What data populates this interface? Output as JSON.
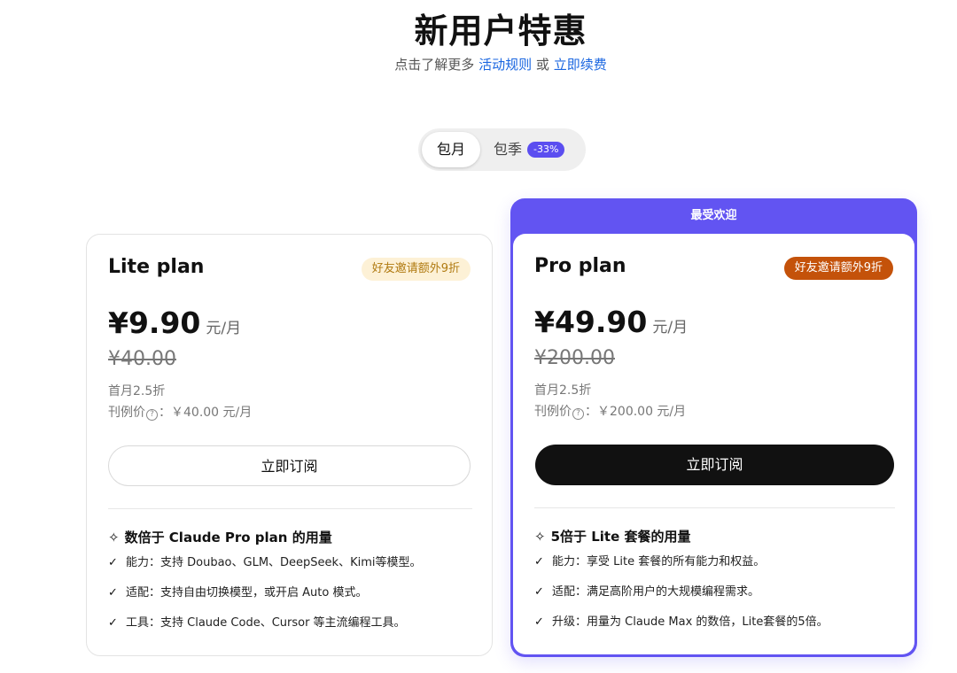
{
  "header": {
    "title": "新用户特惠",
    "subtitle_prefix": "点击了解更多",
    "rules_link": "活动规则",
    "or": "或",
    "renew_link": "立即续费"
  },
  "toggle": {
    "monthly": "包月",
    "quarterly": "包季",
    "quarterly_badge": "-33%",
    "selected": "包月"
  },
  "colors": {
    "accent": "#6254f2",
    "link": "#1a66e0",
    "pro_tag": "#c4520a"
  },
  "plans": [
    {
      "name": "Lite plan",
      "invite_tag": "好友邀请额外9折",
      "price": "¥9.90",
      "unit": "元/月",
      "original_price": "¥40.00",
      "discount": "首月2.5折",
      "ref_label": "刊例价",
      "ref_value": "：￥40.00 元/月",
      "subscribe": "立即订阅",
      "features_title": "数倍于 Claude Pro plan 的用量",
      "features": [
        "能力：支持 Doubao、GLM、DeepSeek、Kimi等模型。",
        "适配：支持自由切换模型，或开启 Auto 模式。",
        "工具：支持 Claude Code、Cursor 等主流编程工具。"
      ]
    },
    {
      "name": "Pro plan",
      "banner": "最受欢迎",
      "invite_tag": "好友邀请额外9折",
      "price": "¥49.90",
      "unit": "元/月",
      "original_price": "¥200.00",
      "discount": "首月2.5折",
      "ref_label": "刊例价",
      "ref_value": "：￥200.00 元/月",
      "subscribe": "立即订阅",
      "features_title": "5倍于 Lite 套餐的用量",
      "features": [
        "能力：享受 Lite 套餐的所有能力和权益。",
        "适配：满足高阶用户的大规模编程需求。",
        "升级：用量为 Claude Max 的数倍，Lite套餐的5倍。"
      ]
    }
  ]
}
